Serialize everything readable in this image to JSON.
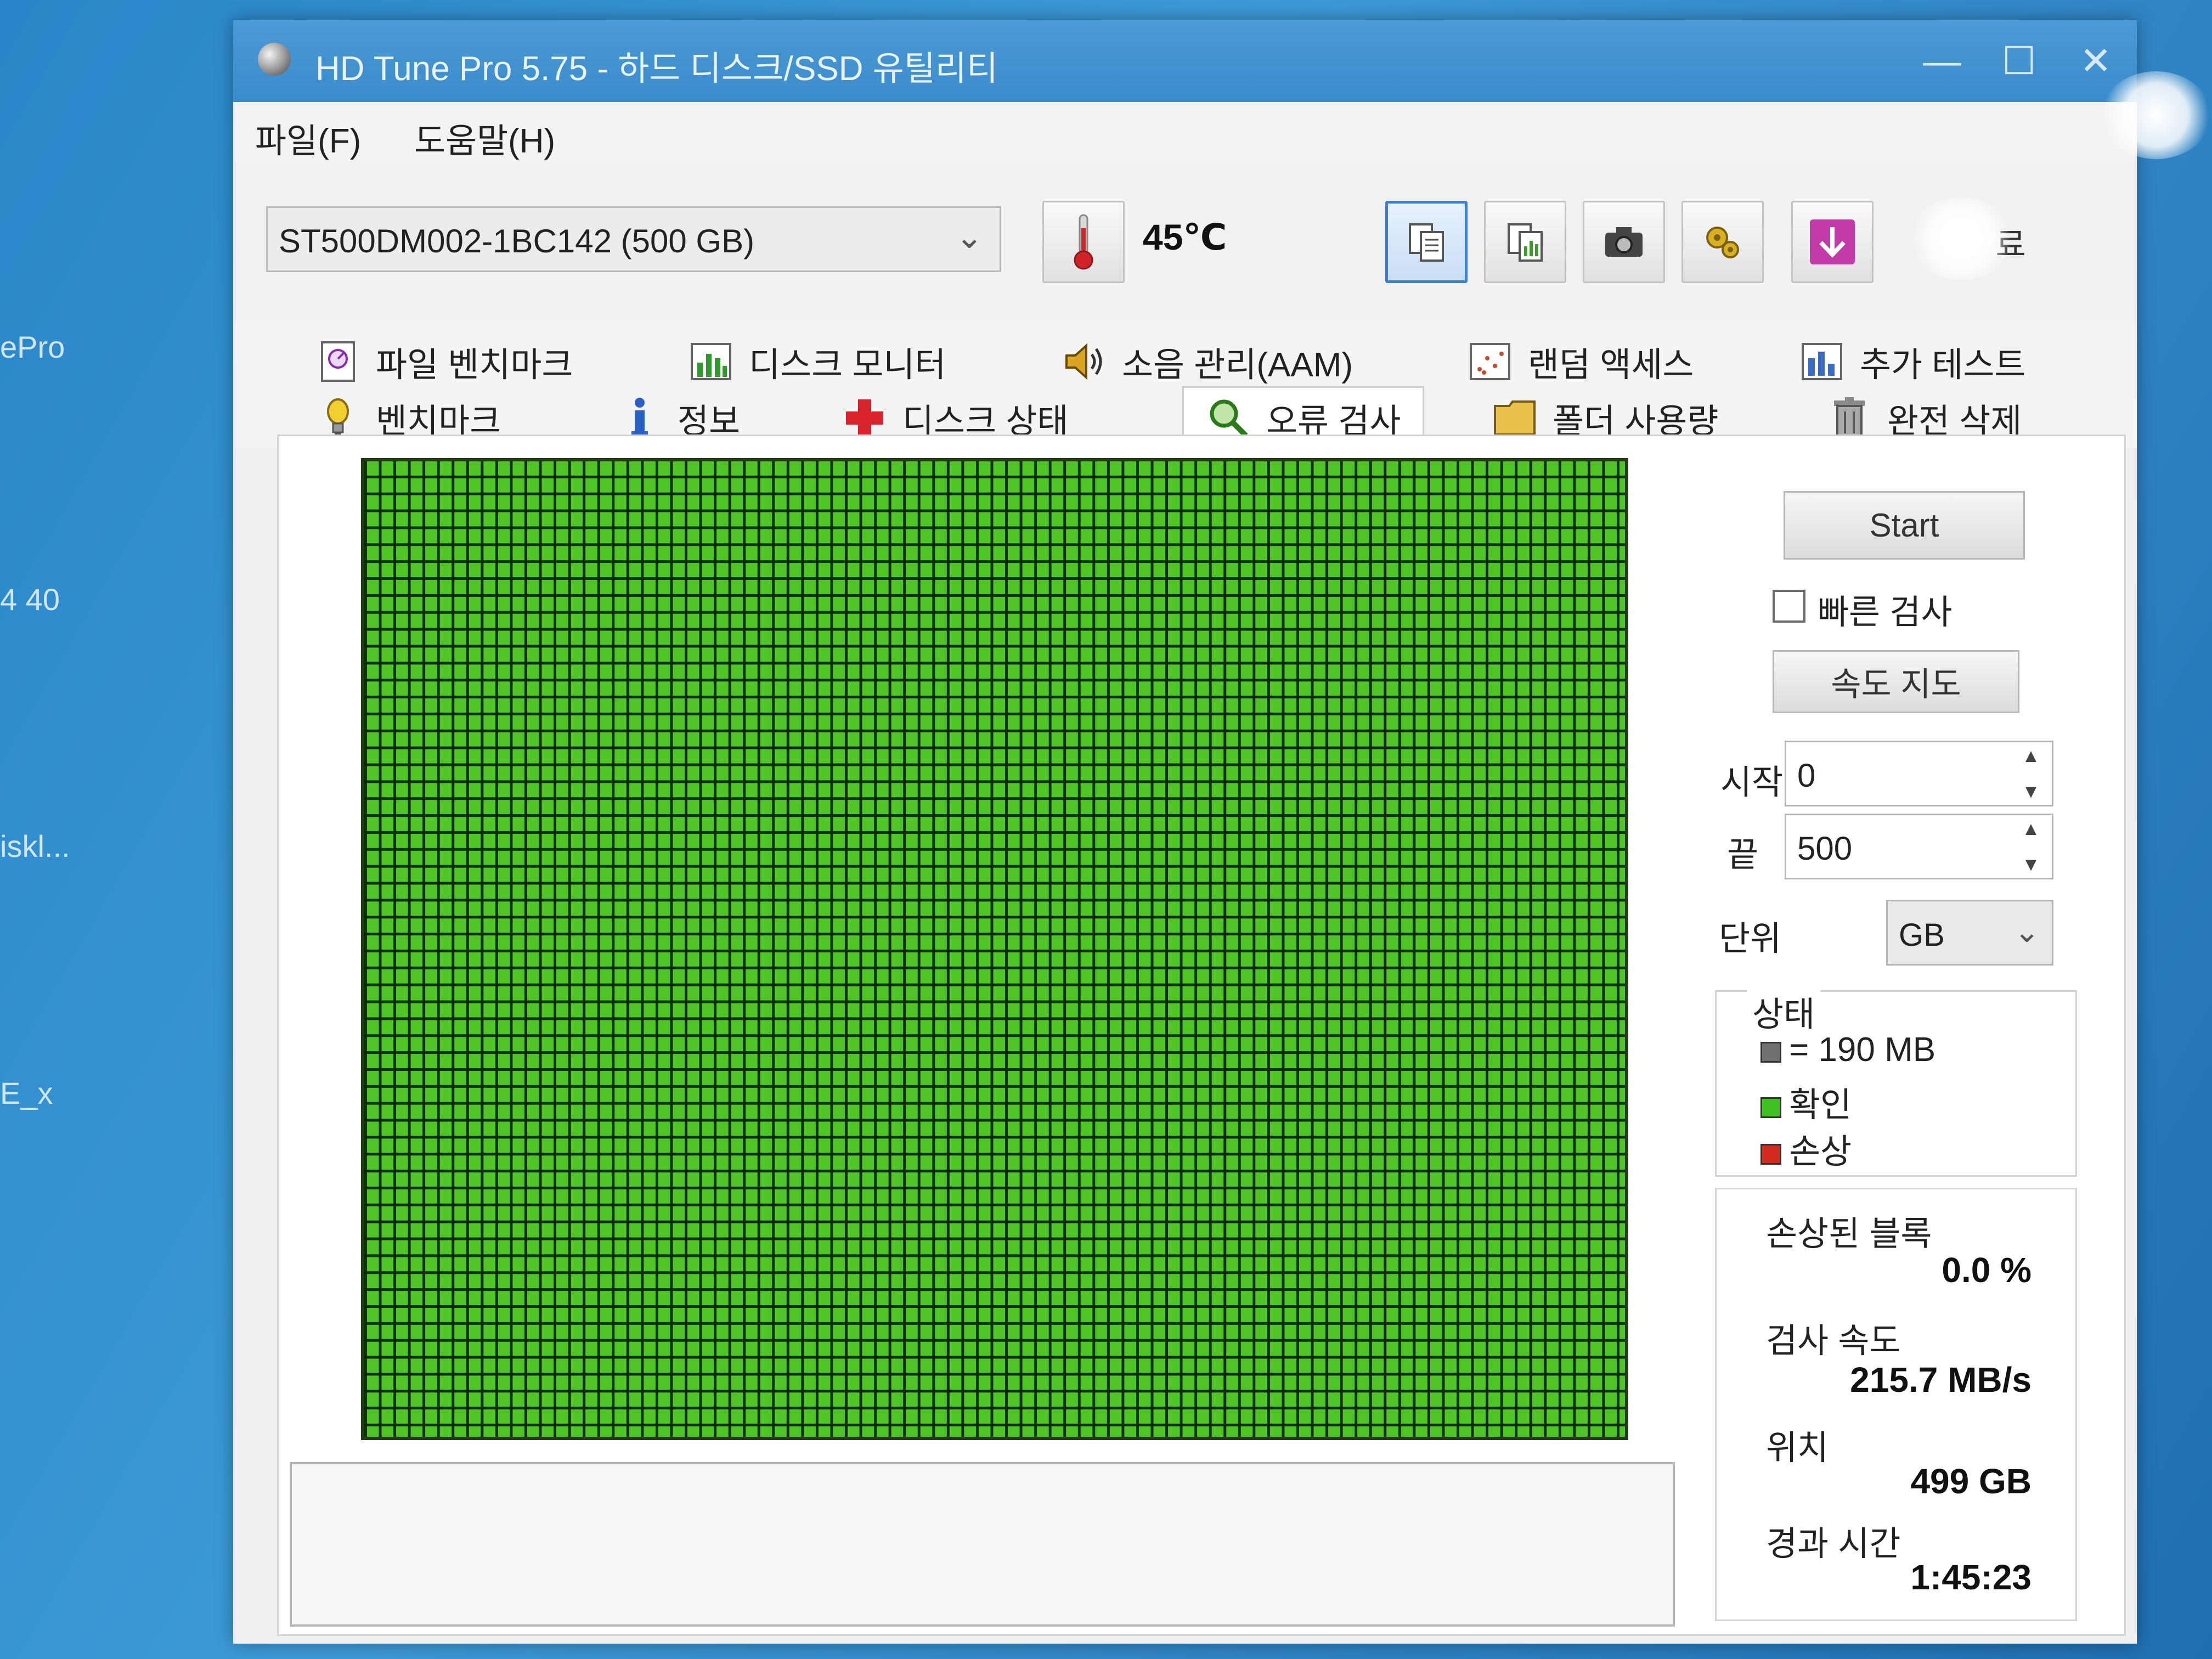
{
  "desktop": {
    "labels": [
      "ePro",
      "4 40",
      "iskl...",
      "E_x"
    ]
  },
  "window": {
    "title": "HD Tune Pro 5.75 - 하드 디스크/SSD 유틸리티",
    "controls": {
      "minimize": "—",
      "maximize": "☐",
      "close": "✕"
    }
  },
  "menu": {
    "file": "파일(F)",
    "help": "도움말(H)"
  },
  "toolbar": {
    "drive": "ST500DM002-1BC142 (500 GB)",
    "temperature": "45℃",
    "exit_label": "료"
  },
  "tabs": {
    "row1": [
      "파일 벤치마크",
      "디스크 모니터",
      "소음 관리(AAM)",
      "랜덤 액세스",
      "추가 테스트"
    ],
    "row2": [
      "벤치마크",
      "정보",
      "디스크 상태",
      "오류 검사",
      "폴더 사용량",
      "완전 삭제"
    ],
    "selected": "오류 검사"
  },
  "error_scan": {
    "start_button": "Start",
    "quick_scan_label": "빠른 검사",
    "quick_scan_checked": false,
    "speed_map_button": "속도 지도",
    "start_label": "시작",
    "start_value": "0",
    "end_label": "끝",
    "end_value": "500",
    "unit_label": "단위",
    "unit_value": "GB",
    "legend_title": "상태",
    "legend": [
      {
        "label": "= 190 MB",
        "color": "#6f6f6f"
      },
      {
        "label": "확인",
        "color": "#3ec21f"
      },
      {
        "label": "손상",
        "color": "#d22a1f"
      }
    ],
    "damaged_label": "손상된 블록",
    "damaged_value": "0.0 %",
    "speed_label": "검사 속도",
    "speed_value": "215.7 MB/s",
    "position_label": "위치",
    "position_value": "499 GB",
    "elapsed_label": "경과 시간",
    "elapsed_value": "1:45:23",
    "block_color": "#4fc626"
  }
}
